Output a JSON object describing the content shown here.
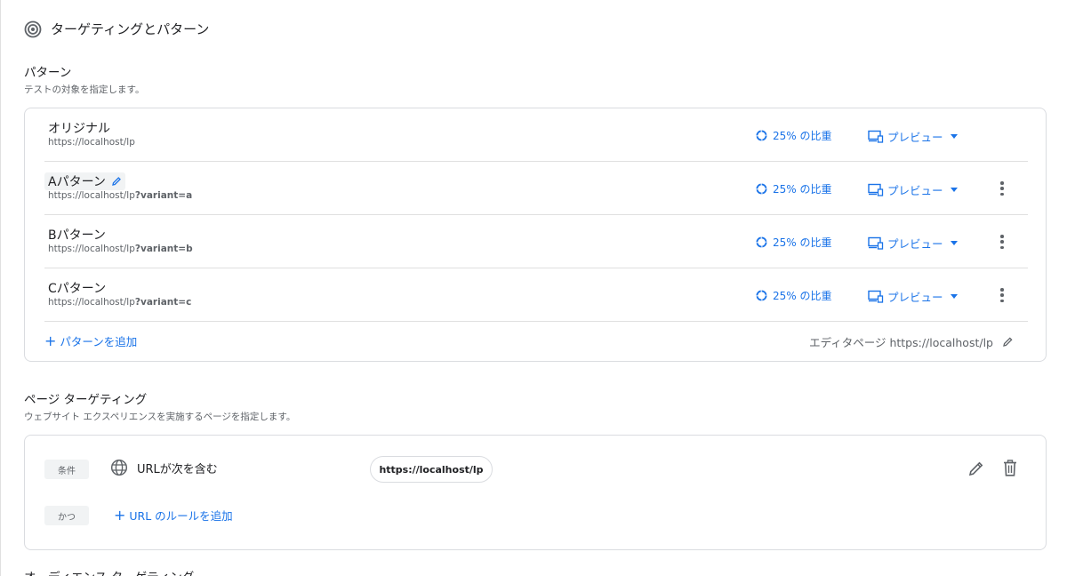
{
  "header": {
    "title": "ターゲティングとパターン",
    "icon": "target-icon"
  },
  "variants_section": {
    "title": "パターン",
    "description": "テストの対象を指定します。",
    "rows": [
      {
        "name": "オリジナル",
        "url_base": "https://localhost/lp",
        "url_param": "",
        "weight": "25% の比重",
        "preview": "プレビュー",
        "editable": false,
        "menu": false
      },
      {
        "name": "Aパターン",
        "url_base": "https://localhost/lp",
        "url_param": "?variant=a",
        "weight": "25% の比重",
        "preview": "プレビュー",
        "editable": true,
        "menu": true
      },
      {
        "name": "Bパターン",
        "url_base": "https://localhost/lp",
        "url_param": "?variant=b",
        "weight": "25% の比重",
        "preview": "プレビュー",
        "editable": false,
        "menu": true
      },
      {
        "name": "Cパターン",
        "url_base": "https://localhost/lp",
        "url_param": "?variant=c",
        "weight": "25% の比重",
        "preview": "プレビュー",
        "editable": false,
        "menu": true
      }
    ],
    "add_label": "パターンを追加",
    "editor_label": "エディタページ https://localhost/lp"
  },
  "page_targeting": {
    "title": "ページ ターゲティング",
    "description": "ウェブサイト エクスペリエンスを実施するページを指定します。",
    "condition_chip": "条件",
    "condition_text": "URLが次を含む",
    "condition_value": "https://localhost/lp",
    "and_chip": "かつ",
    "add_rule_label": "URL のルールを追加"
  },
  "audience_targeting": {
    "title": "オーディエンス ターゲティング"
  },
  "colors": {
    "accent": "#1a73e8",
    "text": "#202124",
    "muted": "#5f6368",
    "border": "#dadce0"
  }
}
